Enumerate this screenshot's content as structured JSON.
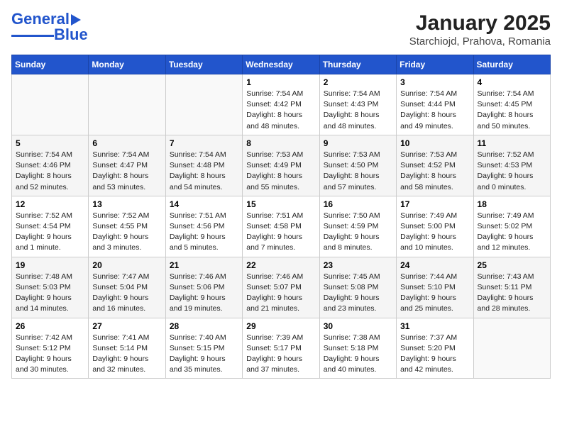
{
  "logo": {
    "line1": "General",
    "line2": "Blue",
    "tagline": ""
  },
  "title": "January 2025",
  "subtitle": "Starchiojd, Prahova, Romania",
  "headers": [
    "Sunday",
    "Monday",
    "Tuesday",
    "Wednesday",
    "Thursday",
    "Friday",
    "Saturday"
  ],
  "weeks": [
    [
      {
        "day": "",
        "info": ""
      },
      {
        "day": "",
        "info": ""
      },
      {
        "day": "",
        "info": ""
      },
      {
        "day": "1",
        "info": "Sunrise: 7:54 AM\nSunset: 4:42 PM\nDaylight: 8 hours and 48 minutes."
      },
      {
        "day": "2",
        "info": "Sunrise: 7:54 AM\nSunset: 4:43 PM\nDaylight: 8 hours and 48 minutes."
      },
      {
        "day": "3",
        "info": "Sunrise: 7:54 AM\nSunset: 4:44 PM\nDaylight: 8 hours and 49 minutes."
      },
      {
        "day": "4",
        "info": "Sunrise: 7:54 AM\nSunset: 4:45 PM\nDaylight: 8 hours and 50 minutes."
      }
    ],
    [
      {
        "day": "5",
        "info": "Sunrise: 7:54 AM\nSunset: 4:46 PM\nDaylight: 8 hours and 52 minutes."
      },
      {
        "day": "6",
        "info": "Sunrise: 7:54 AM\nSunset: 4:47 PM\nDaylight: 8 hours and 53 minutes."
      },
      {
        "day": "7",
        "info": "Sunrise: 7:54 AM\nSunset: 4:48 PM\nDaylight: 8 hours and 54 minutes."
      },
      {
        "day": "8",
        "info": "Sunrise: 7:53 AM\nSunset: 4:49 PM\nDaylight: 8 hours and 55 minutes."
      },
      {
        "day": "9",
        "info": "Sunrise: 7:53 AM\nSunset: 4:50 PM\nDaylight: 8 hours and 57 minutes."
      },
      {
        "day": "10",
        "info": "Sunrise: 7:53 AM\nSunset: 4:52 PM\nDaylight: 8 hours and 58 minutes."
      },
      {
        "day": "11",
        "info": "Sunrise: 7:52 AM\nSunset: 4:53 PM\nDaylight: 9 hours and 0 minutes."
      }
    ],
    [
      {
        "day": "12",
        "info": "Sunrise: 7:52 AM\nSunset: 4:54 PM\nDaylight: 9 hours and 1 minute."
      },
      {
        "day": "13",
        "info": "Sunrise: 7:52 AM\nSunset: 4:55 PM\nDaylight: 9 hours and 3 minutes."
      },
      {
        "day": "14",
        "info": "Sunrise: 7:51 AM\nSunset: 4:56 PM\nDaylight: 9 hours and 5 minutes."
      },
      {
        "day": "15",
        "info": "Sunrise: 7:51 AM\nSunset: 4:58 PM\nDaylight: 9 hours and 7 minutes."
      },
      {
        "day": "16",
        "info": "Sunrise: 7:50 AM\nSunset: 4:59 PM\nDaylight: 9 hours and 8 minutes."
      },
      {
        "day": "17",
        "info": "Sunrise: 7:49 AM\nSunset: 5:00 PM\nDaylight: 9 hours and 10 minutes."
      },
      {
        "day": "18",
        "info": "Sunrise: 7:49 AM\nSunset: 5:02 PM\nDaylight: 9 hours and 12 minutes."
      }
    ],
    [
      {
        "day": "19",
        "info": "Sunrise: 7:48 AM\nSunset: 5:03 PM\nDaylight: 9 hours and 14 minutes."
      },
      {
        "day": "20",
        "info": "Sunrise: 7:47 AM\nSunset: 5:04 PM\nDaylight: 9 hours and 16 minutes."
      },
      {
        "day": "21",
        "info": "Sunrise: 7:46 AM\nSunset: 5:06 PM\nDaylight: 9 hours and 19 minutes."
      },
      {
        "day": "22",
        "info": "Sunrise: 7:46 AM\nSunset: 5:07 PM\nDaylight: 9 hours and 21 minutes."
      },
      {
        "day": "23",
        "info": "Sunrise: 7:45 AM\nSunset: 5:08 PM\nDaylight: 9 hours and 23 minutes."
      },
      {
        "day": "24",
        "info": "Sunrise: 7:44 AM\nSunset: 5:10 PM\nDaylight: 9 hours and 25 minutes."
      },
      {
        "day": "25",
        "info": "Sunrise: 7:43 AM\nSunset: 5:11 PM\nDaylight: 9 hours and 28 minutes."
      }
    ],
    [
      {
        "day": "26",
        "info": "Sunrise: 7:42 AM\nSunset: 5:12 PM\nDaylight: 9 hours and 30 minutes."
      },
      {
        "day": "27",
        "info": "Sunrise: 7:41 AM\nSunset: 5:14 PM\nDaylight: 9 hours and 32 minutes."
      },
      {
        "day": "28",
        "info": "Sunrise: 7:40 AM\nSunset: 5:15 PM\nDaylight: 9 hours and 35 minutes."
      },
      {
        "day": "29",
        "info": "Sunrise: 7:39 AM\nSunset: 5:17 PM\nDaylight: 9 hours and 37 minutes."
      },
      {
        "day": "30",
        "info": "Sunrise: 7:38 AM\nSunset: 5:18 PM\nDaylight: 9 hours and 40 minutes."
      },
      {
        "day": "31",
        "info": "Sunrise: 7:37 AM\nSunset: 5:20 PM\nDaylight: 9 hours and 42 minutes."
      },
      {
        "day": "",
        "info": ""
      }
    ]
  ]
}
